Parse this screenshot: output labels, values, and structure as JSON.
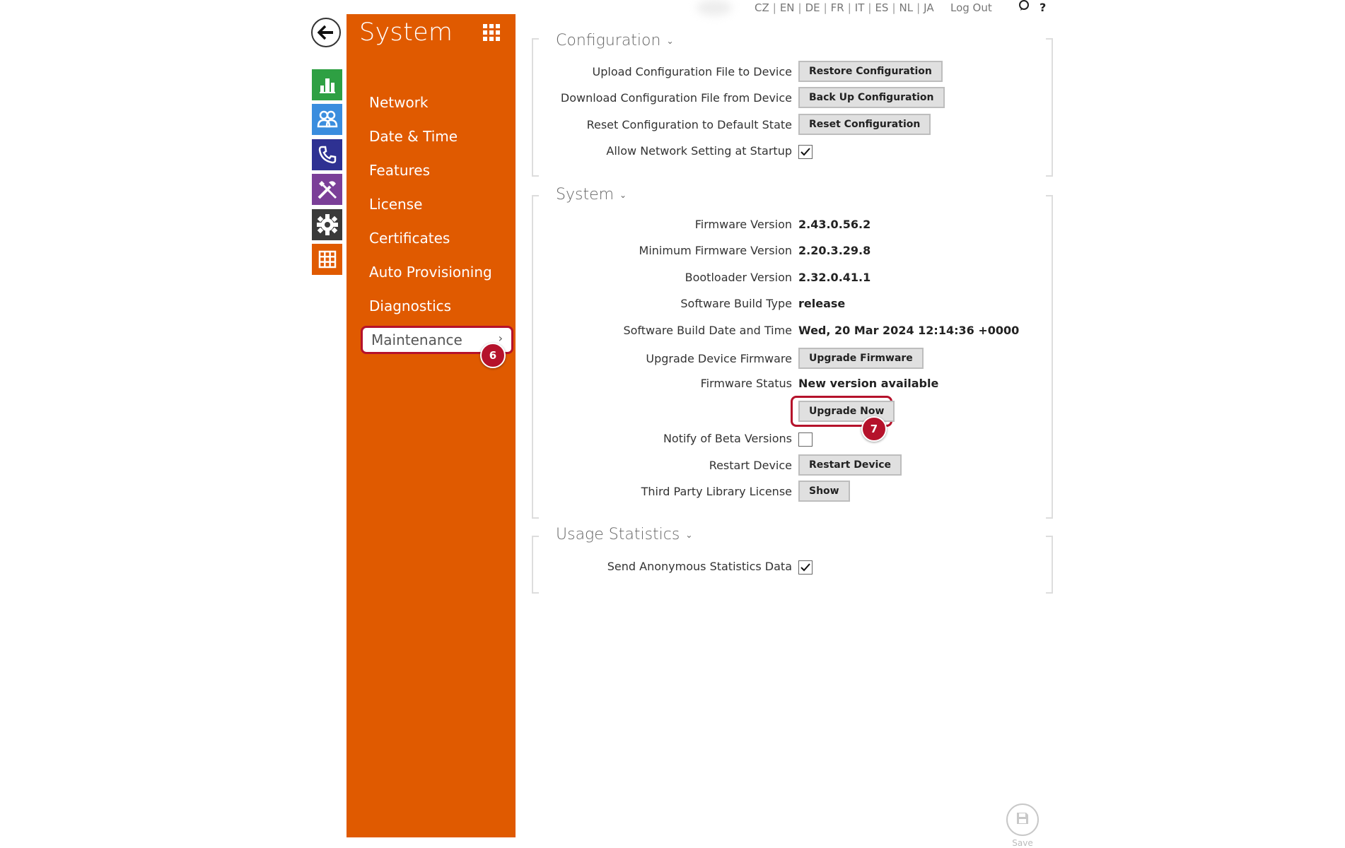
{
  "topbar": {
    "languages": [
      "CZ",
      "EN",
      "DE",
      "FR",
      "IT",
      "ES",
      "NL",
      "JA"
    ],
    "logout_label": "Log Out"
  },
  "sidebar_icons": [
    {
      "name": "status",
      "color": "#2ea043"
    },
    {
      "name": "directory",
      "color": "#3a8dde"
    },
    {
      "name": "calls",
      "color": "#2e3192"
    },
    {
      "name": "hardware",
      "color": "#7b3f98"
    },
    {
      "name": "services",
      "color": "#3a3a3a"
    },
    {
      "name": "system",
      "color": "#e05a00"
    }
  ],
  "menu": {
    "title": "System",
    "items": [
      "Network",
      "Date & Time",
      "Features",
      "License",
      "Certificates",
      "Auto Provisioning",
      "Diagnostics"
    ],
    "active_item": "Maintenance",
    "active_badge": "6",
    "accent_color": "#e05a00"
  },
  "configuration": {
    "title": "Configuration",
    "rows": [
      {
        "label": "Upload Configuration File to Device",
        "button": "Restore Configuration"
      },
      {
        "label": "Download Configuration File from Device",
        "button": "Back Up Configuration"
      },
      {
        "label": "Reset Configuration to Default State",
        "button": "Reset Configuration"
      }
    ],
    "allow_network_label": "Allow Network Setting at Startup",
    "allow_network_checked": true
  },
  "system": {
    "title": "System",
    "firmware_version_label": "Firmware Version",
    "firmware_version": "2.43.0.56.2",
    "min_firmware_label": "Minimum Firmware Version",
    "min_firmware": "2.20.3.29.8",
    "bootloader_label": "Bootloader Version",
    "bootloader": "2.32.0.41.1",
    "build_type_label": "Software Build Type",
    "build_type": "release",
    "build_date_label": "Software Build Date and Time",
    "build_date": "Wed, 20 Mar 2024 12:14:36 +0000",
    "upgrade_label": "Upgrade Device Firmware",
    "upgrade_button": "Upgrade Firmware",
    "status_label": "Firmware Status",
    "status_value": "New version available",
    "upgrade_now_button": "Upgrade Now",
    "upgrade_now_badge": "7",
    "beta_label": "Notify of Beta Versions",
    "beta_checked": false,
    "restart_label": "Restart Device",
    "restart_button": "Restart Device",
    "license_label": "Third Party Library License",
    "license_button": "Show"
  },
  "usage": {
    "title": "Usage Statistics",
    "send_label": "Send Anonymous Statistics Data",
    "send_checked": true
  },
  "save_label": "Save"
}
